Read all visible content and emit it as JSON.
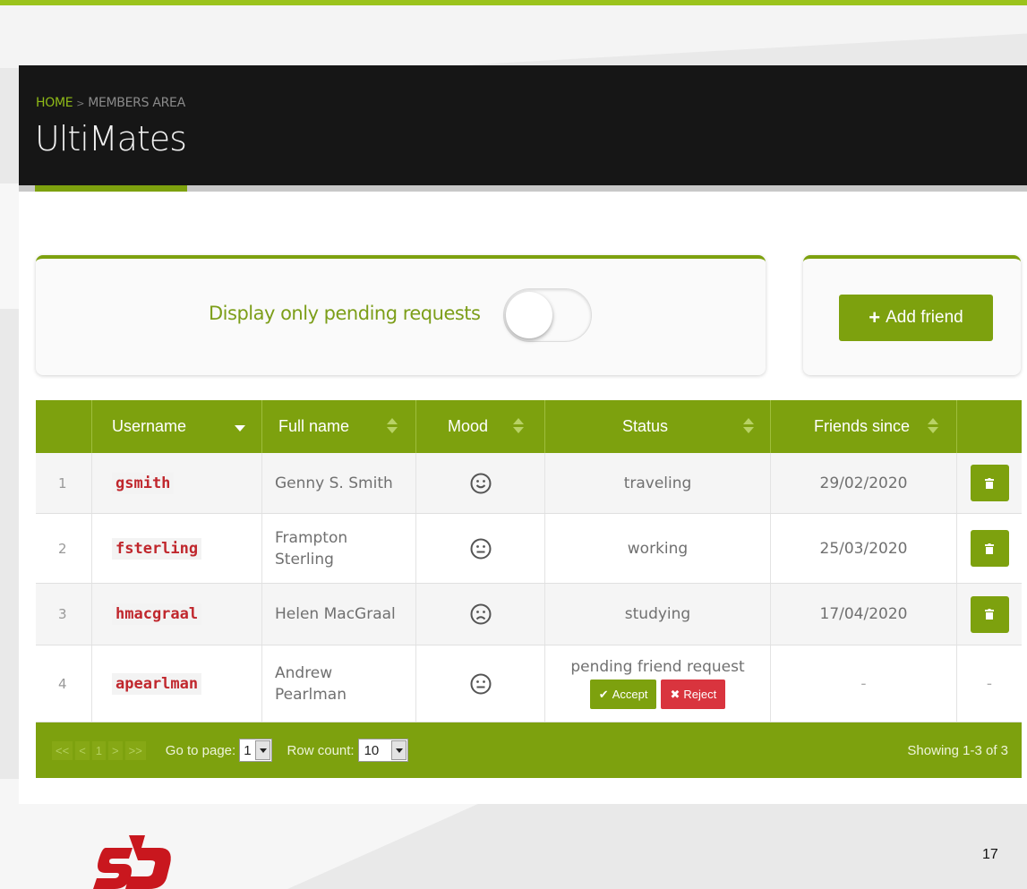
{
  "breadcrumb": {
    "home": "HOME",
    "separator": ">",
    "current": "MEMBERS AREA"
  },
  "page": {
    "title": "UltiMates"
  },
  "filter": {
    "label": "Display only pending requests",
    "enabled": false
  },
  "actions": {
    "add_friend_label": "Add friend",
    "add_friend_icon": "plus-icon"
  },
  "table": {
    "columns": [
      "",
      "Username",
      "Full name",
      "Mood",
      "Status",
      "Friends since",
      ""
    ],
    "rows": [
      {
        "num": "1",
        "username": "gsmith",
        "fullname": "Genny S. Smith",
        "mood": "happy",
        "status": "traveling",
        "since": "29/02/2020",
        "action": "delete"
      },
      {
        "num": "2",
        "username": "fsterling",
        "fullname": "Frampton Sterling",
        "mood": "neutral",
        "status": "working",
        "since": "25/03/2020",
        "action": "delete"
      },
      {
        "num": "3",
        "username": "hmacgraal",
        "fullname": "Helen MacGraal",
        "mood": "sad",
        "status": "studying",
        "since": "17/04/2020",
        "action": "delete"
      },
      {
        "num": "4",
        "username": "apearlman",
        "fullname": "Andrew Pearlman",
        "mood": "neutral",
        "status": "pending friend request",
        "since": "-",
        "action": "-"
      }
    ],
    "accept_label": "Accept",
    "reject_label": "Reject"
  },
  "footer": {
    "pager": [
      "<<",
      "<",
      "1",
      ">",
      ">>"
    ],
    "goto_label": "Go to page:",
    "goto_value": "1",
    "rowcount_label": "Row count:",
    "rowcount_value": "10",
    "showing": "Showing 1-3 of 3"
  },
  "slide_number": "17",
  "colors": {
    "accent": "#7da10e",
    "danger": "#d9343e",
    "username": "#c0272d",
    "header_bg": "#161616"
  }
}
